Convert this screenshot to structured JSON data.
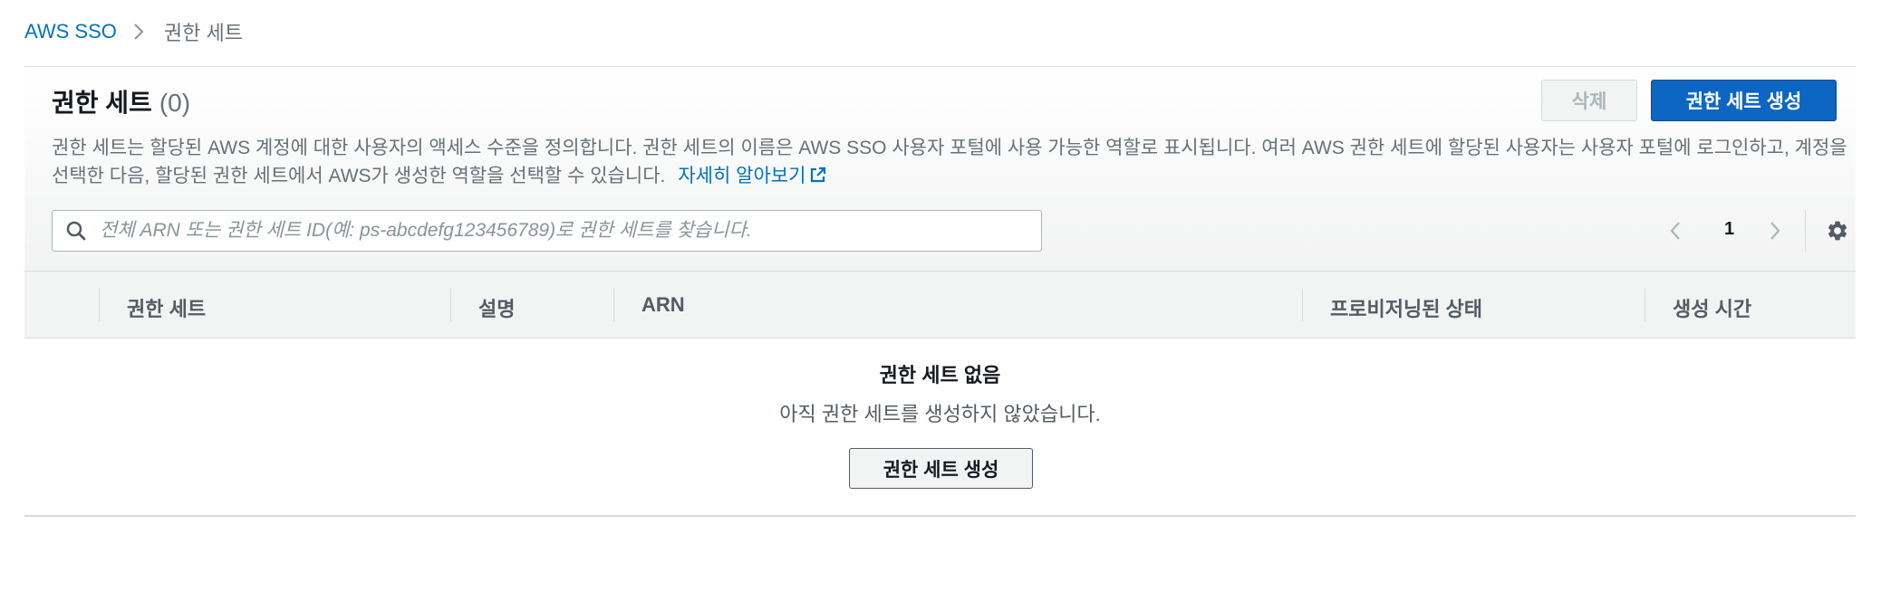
{
  "breadcrumb": {
    "root": "AWS SSO",
    "current": "권한 세트"
  },
  "header": {
    "title": "권한 세트",
    "count": "(0)",
    "delete_label": "삭제",
    "create_label": "권한 세트 생성",
    "description": "권한 세트는 할당된 AWS 계정에 대한 사용자의 액세스 수준을 정의합니다. 권한 세트의 이름은 AWS SSO 사용자 포털에 사용 가능한 역할로 표시됩니다. 여러 AWS 권한 세트에 할당된 사용자는 사용자 포털에 로그인하고, 계정을 선택한 다음, 할당된 권한 세트에서 AWS가 생성한 역할을 선택할 수 있습니다.",
    "learn_more": "자세히 알아보기"
  },
  "search": {
    "placeholder": "전체 ARN 또는 권한 세트 ID(예: ps-abcdefg123456789)로 권한 세트를 찾습니다.",
    "value": ""
  },
  "pagination": {
    "current_page": "1"
  },
  "table": {
    "columns": [
      "권한 세트",
      "설명",
      "ARN",
      "프로비저닝된 상태",
      "생성 시간"
    ]
  },
  "empty_state": {
    "title": "권한 세트 없음",
    "description": "아직 권한 세트를 생성하지 않았습니다.",
    "button_label": "권한 세트 생성"
  },
  "icons": {
    "breadcrumb_separator": "chevron-right-icon",
    "external_link": "external-link-icon",
    "search": "search-icon",
    "prev": "chevron-left-icon",
    "next": "chevron-right-icon",
    "settings": "gear-icon"
  },
  "colors": {
    "primary": "#0d66c2",
    "link": "#0073bb",
    "muted_text": "#687078"
  }
}
